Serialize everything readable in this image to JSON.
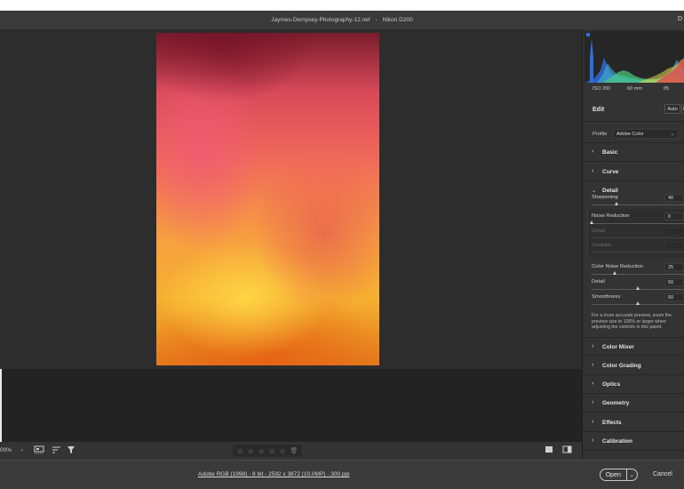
{
  "window": {
    "file_name": "Jaymes-Dempsey-Photography-12.nef",
    "separator": "-",
    "camera": "Nikon D200",
    "corner_glyph": "D"
  },
  "histogram": {
    "colors": [
      "#2f6ee0",
      "#3fb5d8",
      "#4cc97a",
      "#e8d84a",
      "#e04a4a"
    ]
  },
  "meta": {
    "iso": "ISO 200",
    "focal": "60 mm",
    "aperture": "f/5"
  },
  "edit": {
    "title": "Edit",
    "auto": "Auto",
    "bw": "B"
  },
  "profile": {
    "label": "Profile",
    "value": "Adobe Color"
  },
  "sections": {
    "basic": "Basic",
    "curve": "Curve",
    "detail": "Detail",
    "color_mixer": "Color Mixer",
    "color_grading": "Color Grading",
    "optics": "Optics",
    "geometry": "Geometry",
    "effects": "Effects",
    "calibration": "Calibration"
  },
  "detail": {
    "sharpening": {
      "label": "Sharpening",
      "value": "40",
      "level": 0.27
    },
    "noise_reduction": {
      "label": "Noise Reduction",
      "value": "0",
      "level": 0.0
    },
    "nr_detail": {
      "label": "Detail",
      "value": ""
    },
    "nr_contrast": {
      "label": "Contrast",
      "value": ""
    },
    "color_noise_reduction": {
      "label": "Color Noise Reduction",
      "value": "25",
      "level": 0.25
    },
    "cnr_detail": {
      "label": "Detail",
      "value": "50",
      "level": 0.5
    },
    "smoothness": {
      "label": "Smoothness",
      "value": "50",
      "level": 0.5
    },
    "note": "For a more accurate preview, zoom the preview size to 100% or larger when adjusting the controls in this panel."
  },
  "bottombar": {
    "zoom": "00%",
    "stars": [
      "☆",
      "☆",
      "☆",
      "☆",
      "☆"
    ]
  },
  "statusbar": {
    "workflow": "Adobe RGB (1998) - 8 bit - 2592 x 3872 (10.0MP) - 300 ppi",
    "open": "Open",
    "cancel": "Cancel"
  }
}
